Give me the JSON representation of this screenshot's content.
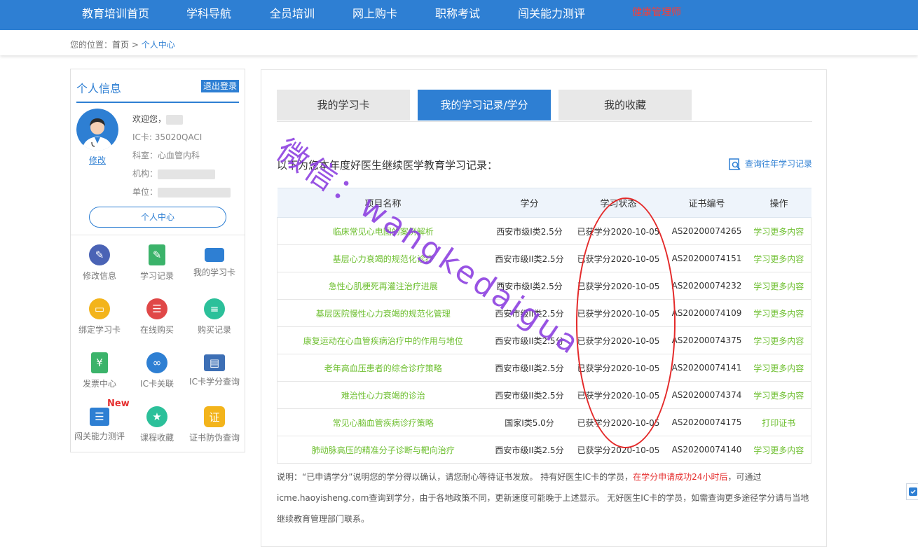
{
  "topnav": {
    "items": [
      "教育培训首页",
      "学科导航",
      "全员培训",
      "网上购卡",
      "职称考试",
      "闯关能力测评",
      "健康管理师"
    ]
  },
  "breadcrumb": {
    "prefix": "您的位置：",
    "home": "首页",
    "sep": " > ",
    "current": "个人中心"
  },
  "profile": {
    "title": "个人信息",
    "logout": "退出登录",
    "welcome": "欢迎您，",
    "ic_card": "IC卡: 35020QACI",
    "dept": "科室：心血管内科",
    "org_label": "机构：",
    "unit_label": "单位：",
    "edit": "修改",
    "center_button": "个人中心"
  },
  "menu": [
    {
      "label": "修改信息",
      "icon": "edit-icon",
      "color": "#4a63b5"
    },
    {
      "label": "学习记录",
      "icon": "study-record-icon",
      "color": "#3bb36a"
    },
    {
      "label": "我的学习卡",
      "icon": "card-icon",
      "color": "#2e7fd3"
    },
    {
      "label": "绑定学习卡",
      "icon": "bind-card-icon",
      "color": "#f3b41b"
    },
    {
      "label": "在线购买",
      "icon": "cart-icon",
      "color": "#e04848"
    },
    {
      "label": "购买记录",
      "icon": "purchase-record-icon",
      "color": "#2cc09a"
    },
    {
      "label": "发票中心",
      "icon": "invoice-icon",
      "color": "#3bb36a"
    },
    {
      "label": "IC卡关联",
      "icon": "link-icon",
      "color": "#2e7fd3"
    },
    {
      "label": "IC卡学分查询",
      "icon": "ic-query-icon",
      "color": "#3d6fb5"
    },
    {
      "label": "闯关能力测评",
      "icon": "assessment-icon",
      "color": "#2e7fd3"
    },
    {
      "label": "课程收藏",
      "icon": "star-icon",
      "color": "#2cc09a"
    },
    {
      "label": "证书防伪查询",
      "icon": "certificate-icon",
      "color": "#f3b41b"
    }
  ],
  "new_badge": "New",
  "tabs": [
    "我的学习卡",
    "我的学习记录/学分",
    "我的收藏"
  ],
  "intro": "以下为您本年度好医生继续医学教育学习记录：",
  "history_link": "查询往年学习记录",
  "table": {
    "headers": [
      "项目名称",
      "学分",
      "学习状态",
      "证书编号",
      "操作"
    ],
    "rows": [
      [
        "临床常见心电图的案例解析",
        "西安市级I类2.5分",
        "已获学分2020-10-05",
        "AS20200074265",
        "学习更多内容"
      ],
      [
        "基层心力衰竭的规范化诊疗",
        "西安市级II类2.5分",
        "已获学分2020-10-05",
        "AS20200074151",
        "学习更多内容"
      ],
      [
        "急性心肌梗死再灌注治疗进展",
        "西安市级I类2.5分",
        "已获学分2020-10-05",
        "AS20200074232",
        "学习更多内容"
      ],
      [
        "基层医院慢性心力衰竭的规范化管理",
        "西安市级II类2.5分",
        "已获学分2020-10-05",
        "AS20200074109",
        "学习更多内容"
      ],
      [
        "康复运动在心血管疾病治疗中的作用与地位",
        "西安市级II类2.5分",
        "已获学分2020-10-05",
        "AS20200074375",
        "学习更多内容"
      ],
      [
        "老年高血压患者的综合诊疗策略",
        "西安市级II类2.5分",
        "已获学分2020-10-05",
        "AS20200074141",
        "学习更多内容"
      ],
      [
        "难治性心力衰竭的诊治",
        "西安市级II类2.5分",
        "已获学分2020-10-05",
        "AS20200074374",
        "学习更多内容"
      ],
      [
        "常见心脑血管疾病诊疗策略",
        "国家I类5.0分",
        "已获学分2020-10-05",
        "AS20200074175",
        "打印证书"
      ],
      [
        "肺动脉高压的精准分子诊断与靶向治疗",
        "西安市级II类2.5分",
        "已获学分2020-10-05",
        "AS20200074140",
        "学习更多内容"
      ]
    ]
  },
  "notes": {
    "part1": "说明：“已申请学分”说明您的学分得以确认，请您耐心等待证书发放。 持有好医生IC卡的学员，",
    "red": "在学分申请成功24小时后",
    "part2": "，可通过",
    "line2": "icme.haoyisheng.com查询到学分，由于各地政策不同，更新速度可能晚于上述显示。 无好医生IC卡的学员，如需查询更多途径学分请与当地",
    "line3": "继续教育管理部门联系。"
  },
  "watermark": "微信：wangkedaigua"
}
